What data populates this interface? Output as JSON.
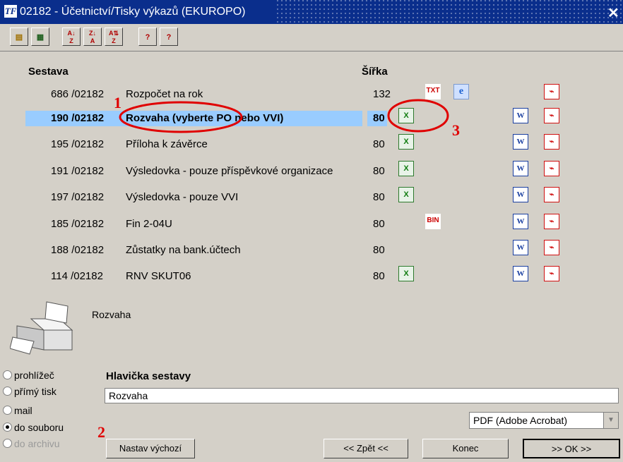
{
  "window": {
    "title": "02182 - Účetnictví/Tisky výkazů (EKUROPO)",
    "app_icon": "TF"
  },
  "toolbar": {
    "buttons": [
      "open-report-icon",
      "edit-report-icon",
      "sort-asc-icon",
      "sort-desc-icon",
      "sort-multi-icon",
      "help-icon",
      "context-help-icon"
    ]
  },
  "list": {
    "col_report": "Sestava",
    "col_width": "Šířka",
    "rows": [
      {
        "id": "686 /02182",
        "name": "Rozpočet na rok",
        "width": "132",
        "formats": [
          "txt",
          "ie",
          "pdf"
        ]
      },
      {
        "id": "190 /02182",
        "name": "Rozvaha (vyberte PO nebo VVI)",
        "width": "80",
        "selected": true,
        "formats": [
          "xls",
          "word",
          "pdf"
        ]
      },
      {
        "id": "195 /02182",
        "name": "Příloha k závěrce",
        "width": "80",
        "formats": [
          "xls",
          "word",
          "pdf"
        ]
      },
      {
        "id": "191 /02182",
        "name": "Výsledovka - pouze příspěvkové organizace",
        "width": "80",
        "formats": [
          "xls",
          "word",
          "pdf"
        ]
      },
      {
        "id": "197 /02182",
        "name": "Výsledovka - pouze VVI",
        "width": "80",
        "formats": [
          "xls",
          "word",
          "pdf"
        ]
      },
      {
        "id": "185 /02182",
        "name": "Fin 2-04U",
        "width": "80",
        "formats": [
          "bin",
          "word",
          "pdf"
        ]
      },
      {
        "id": "188 /02182",
        "name": "Zůstatky na bank.účtech",
        "width": "80",
        "formats": [
          "word",
          "pdf"
        ]
      },
      {
        "id": "114 /02182",
        "name": "RNV SKUT06",
        "width": "80",
        "formats": [
          "xls",
          "word",
          "pdf"
        ]
      }
    ]
  },
  "info": {
    "report_name": "Rozvaha"
  },
  "output": {
    "options": [
      "prohlížeč",
      "přímý tisk",
      "mail",
      "do souboru",
      "do archivu"
    ],
    "selected": "do souboru",
    "header_label": "Hlavička sestavy",
    "header_value": "Rozvaha",
    "format_selected": "PDF (Adobe Acrobat)"
  },
  "buttons": {
    "set_default": "Nastav výchozí",
    "back": "<< Zpět <<",
    "end": "Konec",
    "ok": ">> OK >>"
  },
  "annotations": [
    "1",
    "2",
    "3"
  ],
  "colors": {
    "selection": "#99ccff",
    "annotation": "#e00000",
    "titlebar": "#0a2e8c"
  }
}
